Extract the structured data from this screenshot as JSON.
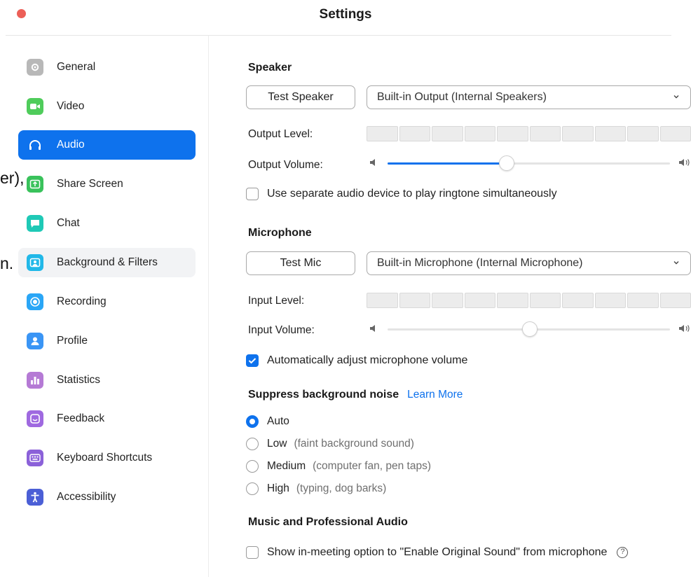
{
  "window": {
    "title": "Settings"
  },
  "background_text": [
    "er),",
    "n."
  ],
  "sidebar": {
    "items": [
      {
        "label": "General",
        "icon": "gear-icon",
        "color": "#b8b8b8"
      },
      {
        "label": "Video",
        "icon": "video-camera-icon",
        "color": "#4fcc5b"
      },
      {
        "label": "Audio",
        "icon": "headphones-icon",
        "color": "#0e72ed"
      },
      {
        "label": "Share Screen",
        "icon": "share-screen-icon",
        "color": "#39c25b"
      },
      {
        "label": "Chat",
        "icon": "chat-bubble-icon",
        "color": "#1fc9b6"
      },
      {
        "label": "Background & Filters",
        "icon": "person-portrait-icon",
        "color": "#21b8e8"
      },
      {
        "label": "Recording",
        "icon": "record-icon",
        "color": "#2aa6f6"
      },
      {
        "label": "Profile",
        "icon": "person-icon",
        "color": "#3a95f5"
      },
      {
        "label": "Statistics",
        "icon": "bar-chart-icon",
        "color": "#b57ad5"
      },
      {
        "label": "Feedback",
        "icon": "smiley-icon",
        "color": "#9f69e0"
      },
      {
        "label": "Keyboard Shortcuts",
        "icon": "keyboard-icon",
        "color": "#8b61d9"
      },
      {
        "label": "Accessibility",
        "icon": "accessibility-icon",
        "color": "#4b5fd6"
      }
    ],
    "active": "Audio"
  },
  "speaker": {
    "heading": "Speaker",
    "test_button": "Test Speaker",
    "device": "Built-in Output (Internal Speakers)",
    "output_level_label": "Output Level:",
    "output_volume_label": "Output Volume:",
    "output_volume_level": 0.42,
    "ringtone_checkbox": "Use separate audio device to play ringtone simultaneously",
    "ringtone_checked": false
  },
  "microphone": {
    "heading": "Microphone",
    "test_button": "Test Mic",
    "device": "Built-in Microphone (Internal Microphone)",
    "input_level_label": "Input Level:",
    "input_volume_label": "Input Volume:",
    "input_volume_level": 0.5,
    "auto_adjust_checkbox": "Automatically adjust microphone volume",
    "auto_adjust_checked": true
  },
  "noise": {
    "heading": "Suppress background noise",
    "learn_more": "Learn More",
    "options": [
      {
        "label": "Auto",
        "desc": "",
        "selected": true
      },
      {
        "label": "Low",
        "desc": "(faint background sound)",
        "selected": false
      },
      {
        "label": "Medium",
        "desc": "(computer fan, pen taps)",
        "selected": false
      },
      {
        "label": "High",
        "desc": "(typing, dog barks)",
        "selected": false
      }
    ]
  },
  "music": {
    "heading": "Music and Professional Audio",
    "original_sound_checkbox": "Show in-meeting option to \"Enable Original Sound\" from microphone",
    "help_icon": "?"
  },
  "colors": {
    "accent": "#0e72ed",
    "close": "#ec5f57"
  }
}
